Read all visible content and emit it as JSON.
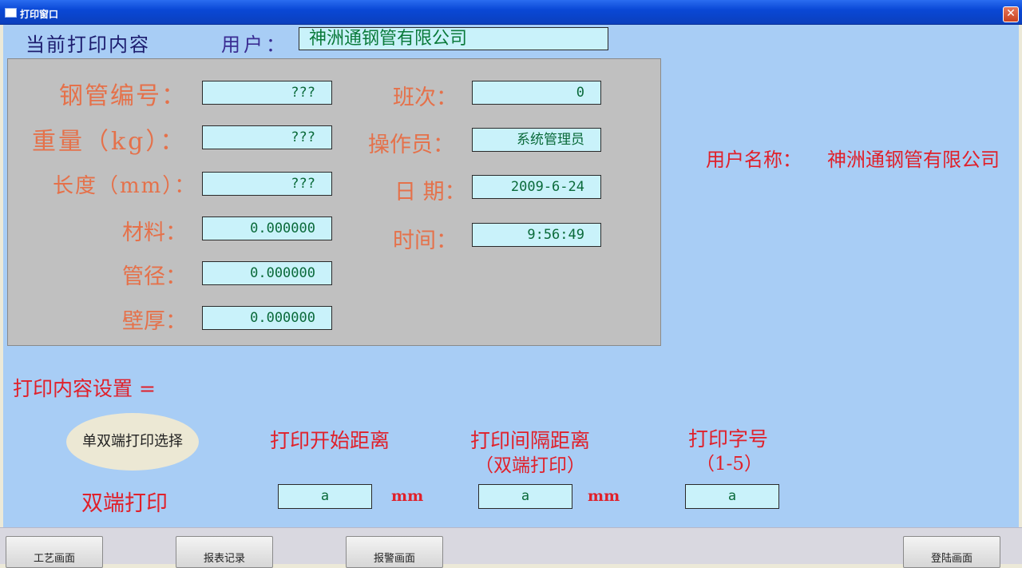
{
  "window": {
    "title": "打印窗口",
    "close_glyph": "✕"
  },
  "header": {
    "current_print_label": "当前打印内容",
    "user_label": "用户：",
    "user_value": "神洲通钢管有限公司"
  },
  "panel": {
    "left": [
      {
        "label": "钢管编号：",
        "value": "???"
      },
      {
        "label": "重量（kg）：",
        "value": "???"
      },
      {
        "label": "长度（mm）：",
        "value": "???"
      },
      {
        "label": "材料：",
        "value": "0.000000"
      },
      {
        "label": "管径：",
        "value": "0.000000"
      },
      {
        "label": "壁厚：",
        "value": "0.000000"
      }
    ],
    "right": [
      {
        "label": "班次：",
        "value": "0"
      },
      {
        "label": "操作员：",
        "value": "系统管理员"
      },
      {
        "label": "日 期：",
        "value": "2009-6-24"
      },
      {
        "label": "时间：",
        "value": "9:56:49"
      }
    ]
  },
  "user_name": {
    "label": "用户名称：",
    "value": "神洲通钢管有限公司"
  },
  "print_settings": {
    "title": "打印内容设置 =",
    "mode_button": "单双端打印选择",
    "mode_value": "双端打印",
    "start_distance": {
      "label": "打印开始距离",
      "value": "a",
      "unit": "mm"
    },
    "interval_distance": {
      "label": "打印间隔距离",
      "sublabel": "（双端打印）",
      "value": "a",
      "unit": "mm"
    },
    "font_size": {
      "label": "打印字号",
      "sublabel": "（1-5）",
      "value": "a"
    }
  },
  "nav": {
    "process": "工艺画面",
    "report": "报表记录",
    "alarm": "报警画面",
    "login": "登陆画面"
  },
  "colors": {
    "background": "#a8cdf5",
    "panel": "#c0c0c0",
    "field": "#c9f2fa",
    "label_orange": "#e5714a",
    "label_red": "#e0202a"
  }
}
